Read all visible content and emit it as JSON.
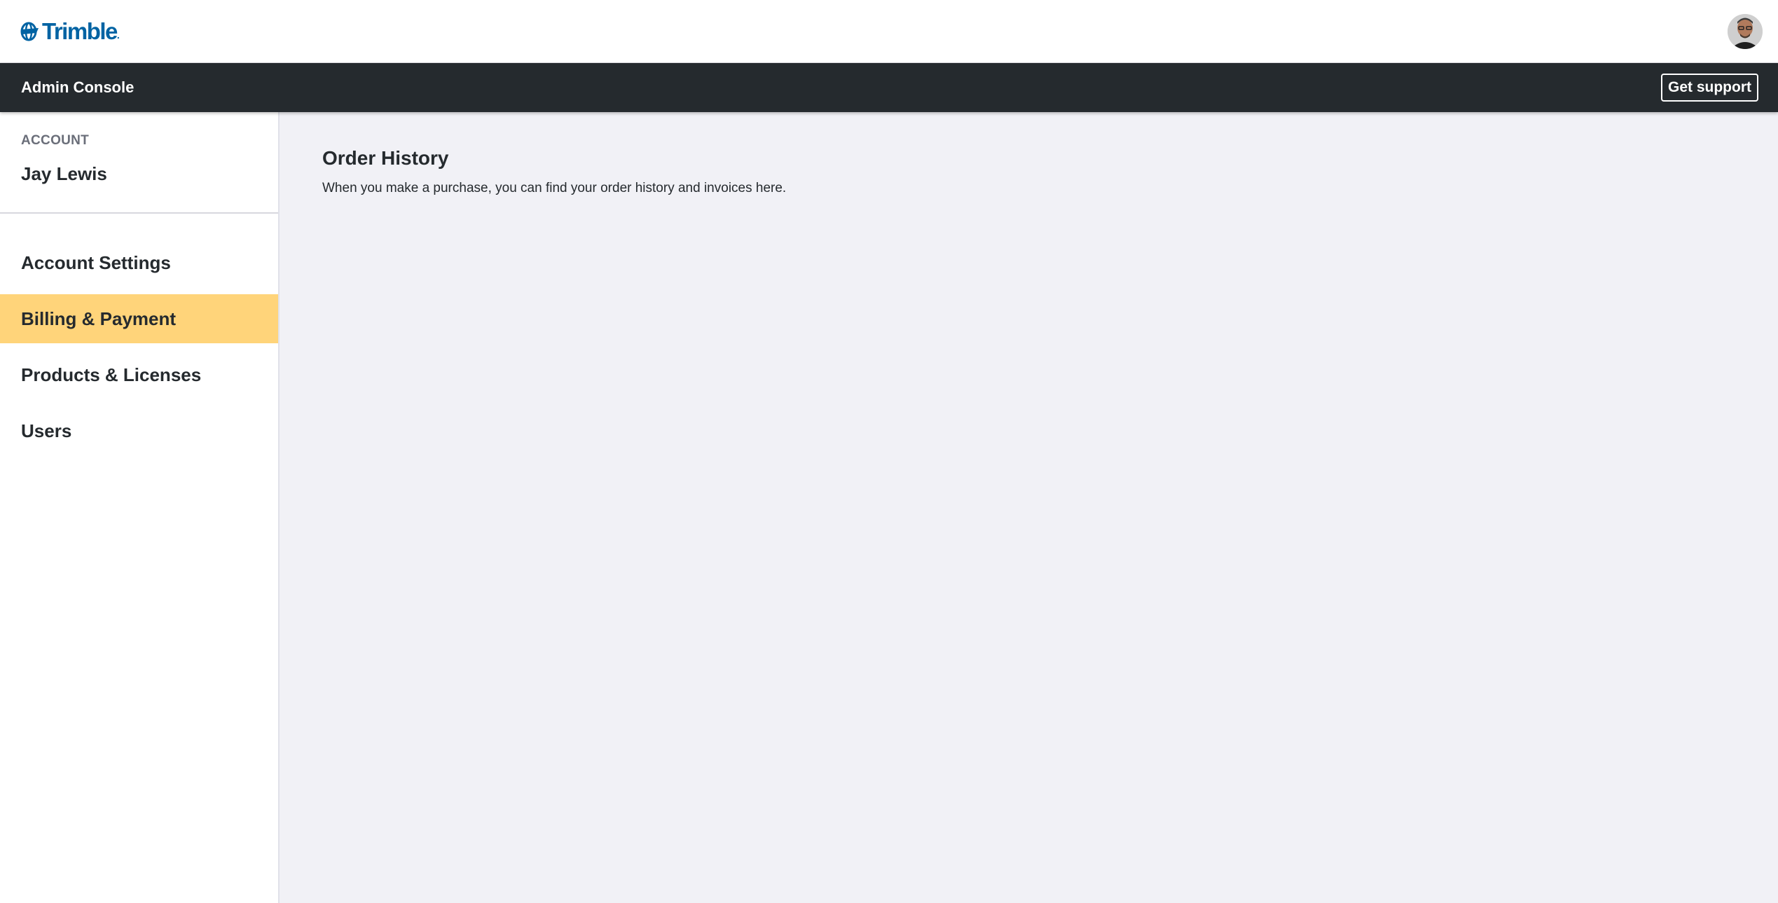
{
  "header": {
    "logo_text": "Trimble",
    "logo_dot": ".",
    "brand_color": "#0063a3",
    "avatar_icon": "user-avatar"
  },
  "navbar": {
    "title": "Admin Console",
    "support_label": "Get support"
  },
  "sidebar": {
    "account_label": "ACCOUNT",
    "account_name": "Jay Lewis",
    "items": [
      {
        "label": "Account Settings",
        "active": false
      },
      {
        "label": "Billing & Payment",
        "active": true
      },
      {
        "label": "Products & Licenses",
        "active": false
      },
      {
        "label": "Users",
        "active": false
      }
    ],
    "active_color": "#ffd47a"
  },
  "main": {
    "title": "Order History",
    "description": "When you make a purchase, you can find your order history and invoices here."
  }
}
